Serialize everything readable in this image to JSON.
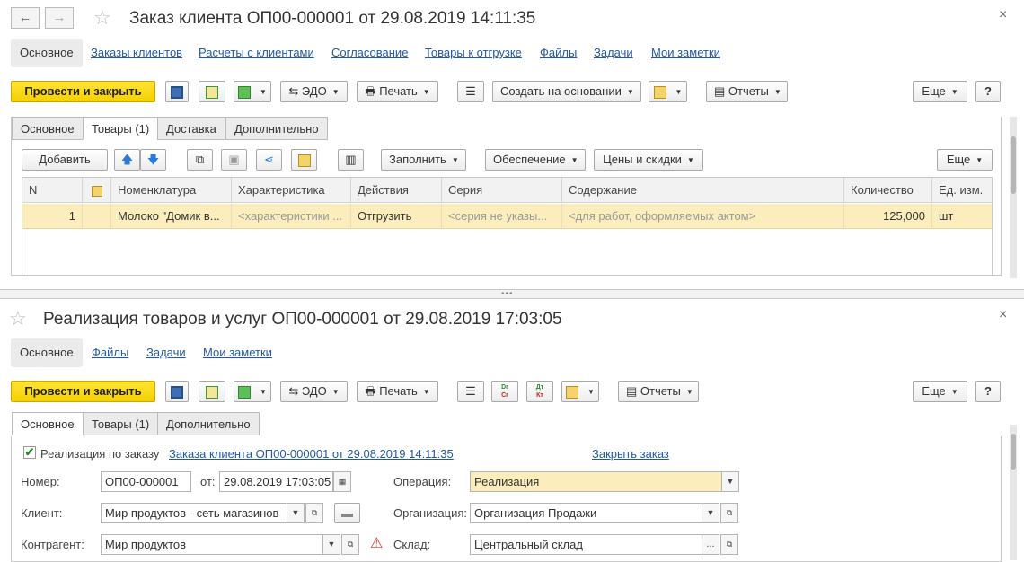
{
  "doc1": {
    "title": "Заказ клиента ОП00-000001 от 29.08.2019 14:11:35",
    "nav_tabs": [
      "Основное",
      "Заказы клиентов",
      "Расчеты с клиентами",
      "Согласование",
      "Товары к отгрузке",
      "Файлы",
      "Задачи",
      "Мои заметки"
    ],
    "toolbar": {
      "post_close": "Провести и закрыть",
      "edo": "ЭДО",
      "print": "Печать",
      "create_based": "Создать на основании",
      "reports": "Отчеты",
      "more": "Еще",
      "help": "?"
    },
    "form_tabs": [
      "Основное",
      "Товары (1)",
      "Доставка",
      "Дополнительно"
    ],
    "goods_toolbar": {
      "add": "Добавить",
      "fill": "Заполнить",
      "provision": "Обеспечение",
      "prices": "Цены и скидки",
      "more": "Еще"
    },
    "table": {
      "headers": [
        "N",
        "Номенклатура",
        "Характеристика",
        "Действия",
        "Серия",
        "Содержание",
        "Количество",
        "Ед. изм."
      ],
      "rows": [
        {
          "n": "1",
          "item": "Молоко \"Домик в...",
          "characteristic": "<характеристики ...",
          "action": "Отгрузить",
          "series": "<серия не указы...",
          "content": "<для работ, оформляемых актом>",
          "qty": "125,000",
          "unit": "шт"
        }
      ]
    }
  },
  "doc2": {
    "title": "Реализация товаров и услуг ОП00-000001 от 29.08.2019 17:03:05",
    "nav_tabs": [
      "Основное",
      "Файлы",
      "Задачи",
      "Мои заметки"
    ],
    "toolbar": {
      "post_close": "Провести и закрыть",
      "edo": "ЭДО",
      "print": "Печать",
      "dt_top": "Dr",
      "dt_bottom": "Cr",
      "kt_top": "Дт",
      "kt_bottom": "Кт",
      "reports": "Отчеты",
      "more": "Еще",
      "help": "?"
    },
    "form_tabs": [
      "Основное",
      "Товары (1)",
      "Дополнительно"
    ],
    "by_order_label": "Реализация по заказу",
    "by_order_checked": true,
    "order_link": "Заказа клиента ОП00-000001 от 29.08.2019 14:11:35",
    "close_order": "Закрыть заказ",
    "fields": {
      "number_label": "Номер:",
      "number": "ОП00-000001",
      "date_label": "от:",
      "date": "29.08.2019 17:03:05",
      "operation_label": "Операция:",
      "operation": "Реализация",
      "client_label": "Клиент:",
      "client": "Мир продуктов - сеть магазинов",
      "org_label": "Организация:",
      "org": "Организация Продажи",
      "counterparty_label": "Контрагент:",
      "counterparty": "Мир продуктов",
      "warehouse_label": "Склад:",
      "warehouse": "Центральный склад"
    }
  },
  "colors": {
    "accent": "#f5d000",
    "link": "#2259a6",
    "row_highlight": "#fbeebc",
    "warning": "#d9322c"
  }
}
